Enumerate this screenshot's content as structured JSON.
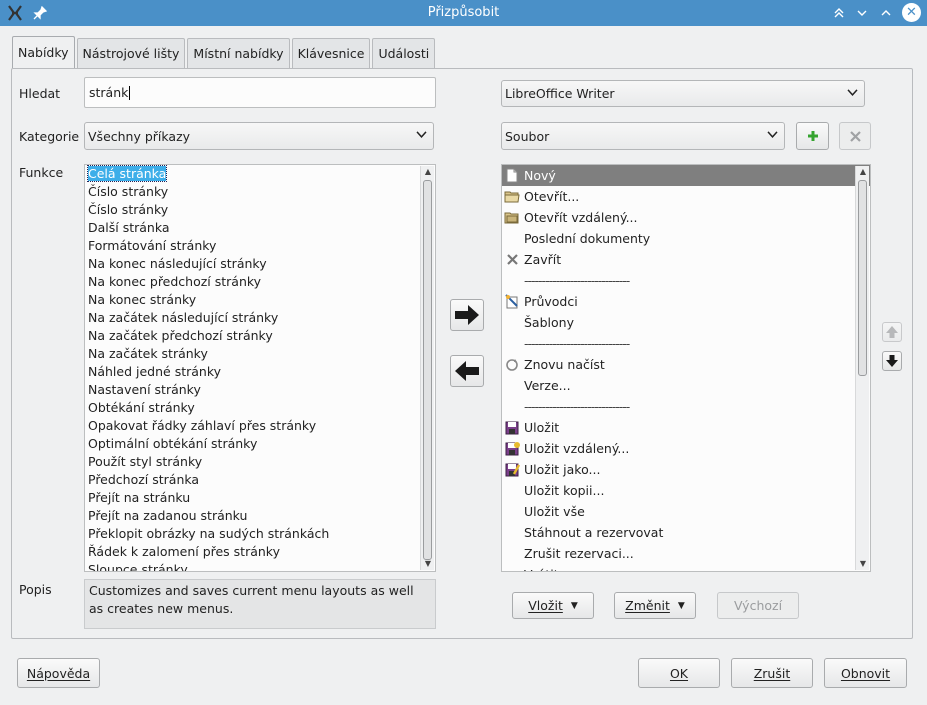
{
  "window": {
    "title": "Přizpůsobit"
  },
  "tabs": [
    {
      "label": "Nabídky",
      "active": true
    },
    {
      "label": "Nástrojové lišty",
      "active": false
    },
    {
      "label": "Místní nabídky",
      "active": false
    },
    {
      "label": "Klávesnice",
      "active": false
    },
    {
      "label": "Události",
      "active": false
    }
  ],
  "search": {
    "label": "Hledat",
    "value": "stránk"
  },
  "category": {
    "label": "Kategorie",
    "value": "Všechny příkazy"
  },
  "functions": {
    "label": "Funkce",
    "items": [
      "Celá stránka",
      "Číslo stránky",
      "Číslo stránky",
      "Další stránka",
      "Formátování stránky",
      "Na konec následující stránky",
      "Na konec předchozí stránky",
      "Na konec stránky",
      "Na začátek následující stránky",
      "Na začátek předchozí stránky",
      "Na začátek stránky",
      "Náhled jedné stránky",
      "Nastavení stránky",
      "Obtékání stránky",
      "Opakovat řádky záhlaví přes stránky",
      "Optimální obtékání stránky",
      "Použít styl stránky",
      "Předchozí stránka",
      "Přejít na stránku",
      "Přejít na zadanou stránku",
      "Překlopit obrázky na sudých stránkách",
      "Řádek k zalomení přes stránky",
      "Sloupce stránky"
    ],
    "selected_index": 0
  },
  "description": {
    "label": "Popis",
    "text": "Customizes and saves current menu layouts as well as creates new menus."
  },
  "target": {
    "application": "LibreOffice Writer",
    "menu": "Soubor"
  },
  "menu_entries": [
    {
      "label": "Nový",
      "icon": "new-document-icon",
      "selected": true
    },
    {
      "label": "Otevřít...",
      "icon": "folder-open-icon"
    },
    {
      "label": "Otevřít vzdálený...",
      "icon": "folder-remote-icon"
    },
    {
      "label": "Poslední dokumenty",
      "icon": ""
    },
    {
      "label": "Zavřít",
      "icon": "close-x-icon"
    },
    {
      "label": "------------------------------",
      "icon": "",
      "separator": true
    },
    {
      "label": "Průvodci",
      "icon": "wizard-icon"
    },
    {
      "label": "Šablony",
      "icon": ""
    },
    {
      "label": "------------------------------",
      "icon": "",
      "separator": true
    },
    {
      "label": "Znovu načíst",
      "icon": "reload-icon"
    },
    {
      "label": "Verze...",
      "icon": ""
    },
    {
      "label": "------------------------------",
      "icon": "",
      "separator": true
    },
    {
      "label": "Uložit",
      "icon": "save-icon"
    },
    {
      "label": "Uložit vzdálený...",
      "icon": "save-remote-icon"
    },
    {
      "label": "Uložit jako...",
      "icon": "save-as-icon"
    },
    {
      "label": "Uložit kopii...",
      "icon": ""
    },
    {
      "label": "Uložit vše",
      "icon": ""
    },
    {
      "label": "Stáhnout a rezervovat",
      "icon": ""
    },
    {
      "label": "Zrušit rezervaci...",
      "icon": ""
    },
    {
      "label": "Vrátit",
      "icon": ""
    }
  ],
  "bottom_buttons": {
    "insert": "Vložit",
    "modify": "Změnit",
    "defaults": "Výchozí"
  },
  "footer": {
    "help": "Nápověda",
    "ok": "OK",
    "cancel": "Zrušit",
    "reset": "Obnovit"
  }
}
